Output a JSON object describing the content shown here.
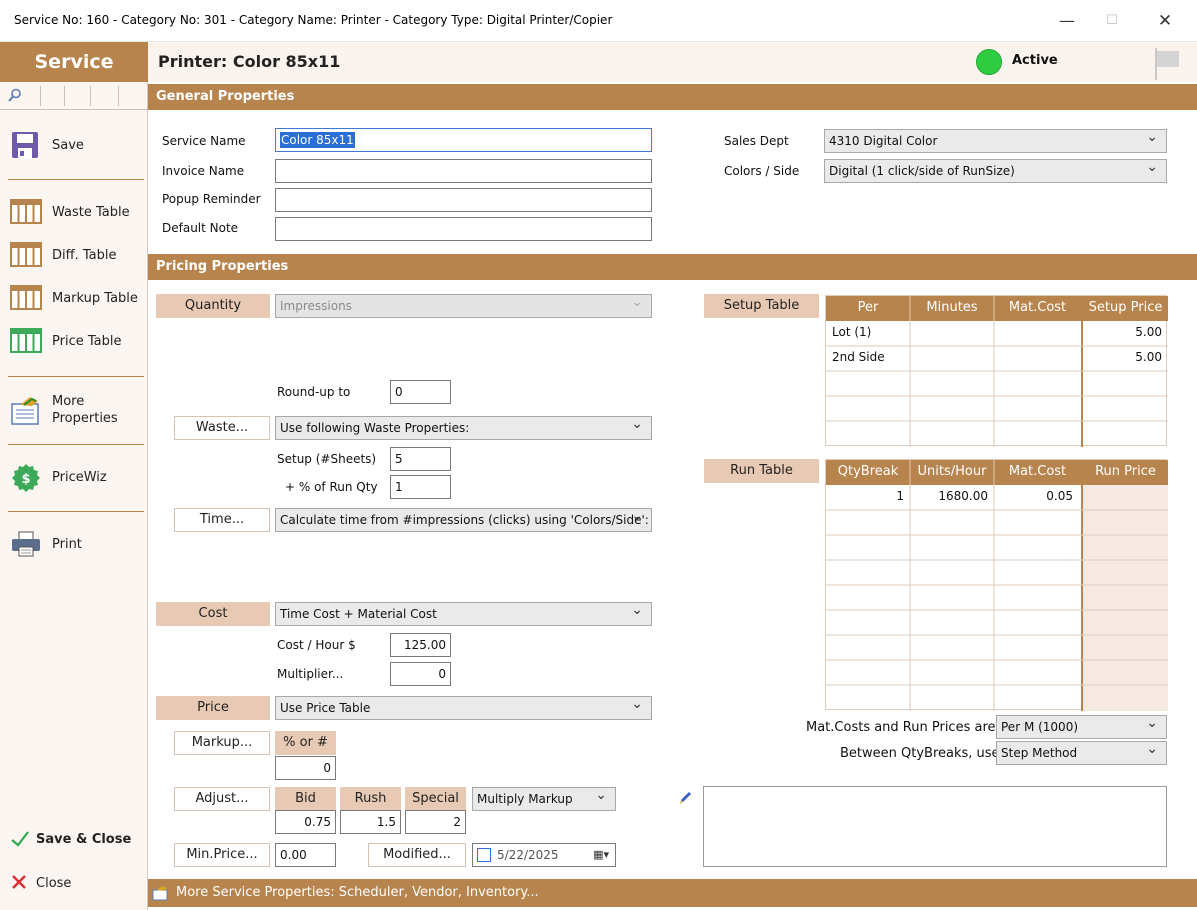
{
  "window": {
    "title": "Service No: 160  -  Category No: 301  -  Category Name: Printer  -  Category Type: Digital Printer/Copier",
    "minimize": "—",
    "maximize": "☐",
    "close": "✕"
  },
  "sidebar": {
    "header": "Service",
    "items": {
      "save": "Save",
      "waste_table": "Waste Table",
      "diff_table": "Diff. Table",
      "markup_table": "Markup Table",
      "price_table": "Price Table",
      "more_properties_1": "More",
      "more_properties_2": "Properties",
      "pricewiz": "PriceWiz",
      "print": "Print",
      "save_close": "Save & Close",
      "close": "Close"
    }
  },
  "header": {
    "title": "Printer: Color 85x11",
    "status": "Active",
    "status_color": "#2ecc40"
  },
  "general": {
    "section_title": "General Properties",
    "service_name_label": "Service Name",
    "service_name_value": "Color 85x11",
    "invoice_name_label": "Invoice Name",
    "invoice_name_value": "",
    "popup_reminder_label": "Popup Reminder",
    "popup_reminder_value": "",
    "default_note_label": "Default Note",
    "default_note_value": "",
    "sales_dept_label": "Sales Dept",
    "sales_dept_value": "4310 Digital Color",
    "colors_side_label": "Colors / Side",
    "colors_side_value": "Digital   (1 click/side of RunSize)"
  },
  "pricing": {
    "section_title": "Pricing Properties",
    "quantity_label": "Quantity",
    "quantity_value": "Impressions",
    "roundup_label": "Round-up to",
    "roundup_value": "0",
    "waste_button": "Waste...",
    "waste_value": "Use following Waste Properties:",
    "setup_sheets_label": "Setup (#Sheets)",
    "setup_sheets_value": "5",
    "pct_run_label": "+ % of Run Qty",
    "pct_run_value": "1",
    "time_button": "Time...",
    "time_value": "Calculate time from #impressions (clicks) using 'Colors/Side':",
    "cost_label": "Cost",
    "cost_value": "Time Cost + Material Cost",
    "cost_hour_label": "Cost / Hour  $",
    "cost_hour_value": "125.00",
    "multiplier_label": "Multiplier...",
    "multiplier_value": "0",
    "price_label": "Price",
    "price_value": "Use Price Table",
    "markup_button": "Markup...",
    "markup_pct_label": "% or #",
    "markup_value": "0",
    "adjust_button": "Adjust...",
    "bid_label": "Bid",
    "bid_value": "0.75",
    "rush_label": "Rush",
    "rush_value": "1.5",
    "special_label": "Special",
    "special_value": "2",
    "adjust_mode": "Multiply Markup",
    "minprice_button": "Min.Price...",
    "minprice_value": "0.00",
    "modified_button": "Modified...",
    "modified_date": "5/22/2025"
  },
  "setup_table": {
    "label": "Setup Table",
    "headers": [
      "Per",
      "Minutes",
      "Mat.Cost",
      "Setup Price"
    ],
    "rows": [
      [
        "Lot (1)",
        "",
        "",
        "5.00"
      ],
      [
        "2nd Side",
        "",
        "",
        "5.00"
      ],
      [
        "",
        "",
        "",
        ""
      ],
      [
        "",
        "",
        "",
        ""
      ],
      [
        "",
        "",
        "",
        ""
      ]
    ]
  },
  "run_table": {
    "label": "Run Table",
    "headers": [
      "QtyBreak",
      "Units/Hour",
      "Mat.Cost",
      "Run Price"
    ],
    "rows": [
      [
        "1",
        "1680.00",
        "0.05",
        ""
      ],
      [
        "",
        "",
        "",
        ""
      ],
      [
        "",
        "",
        "",
        ""
      ],
      [
        "",
        "",
        "",
        ""
      ],
      [
        "",
        "",
        "",
        ""
      ],
      [
        "",
        "",
        "",
        ""
      ],
      [
        "",
        "",
        "",
        ""
      ],
      [
        "",
        "",
        "",
        ""
      ],
      [
        "",
        "",
        "",
        ""
      ]
    ]
  },
  "table_options": {
    "matcost_label": "Mat.Costs and Run Prices are",
    "matcost_value": "Per M (1000)",
    "between_label": "Between QtyBreaks, use",
    "between_value": "Step Method"
  },
  "footer": {
    "text": "More Service Properties: Scheduler, Vendor, Inventory..."
  }
}
